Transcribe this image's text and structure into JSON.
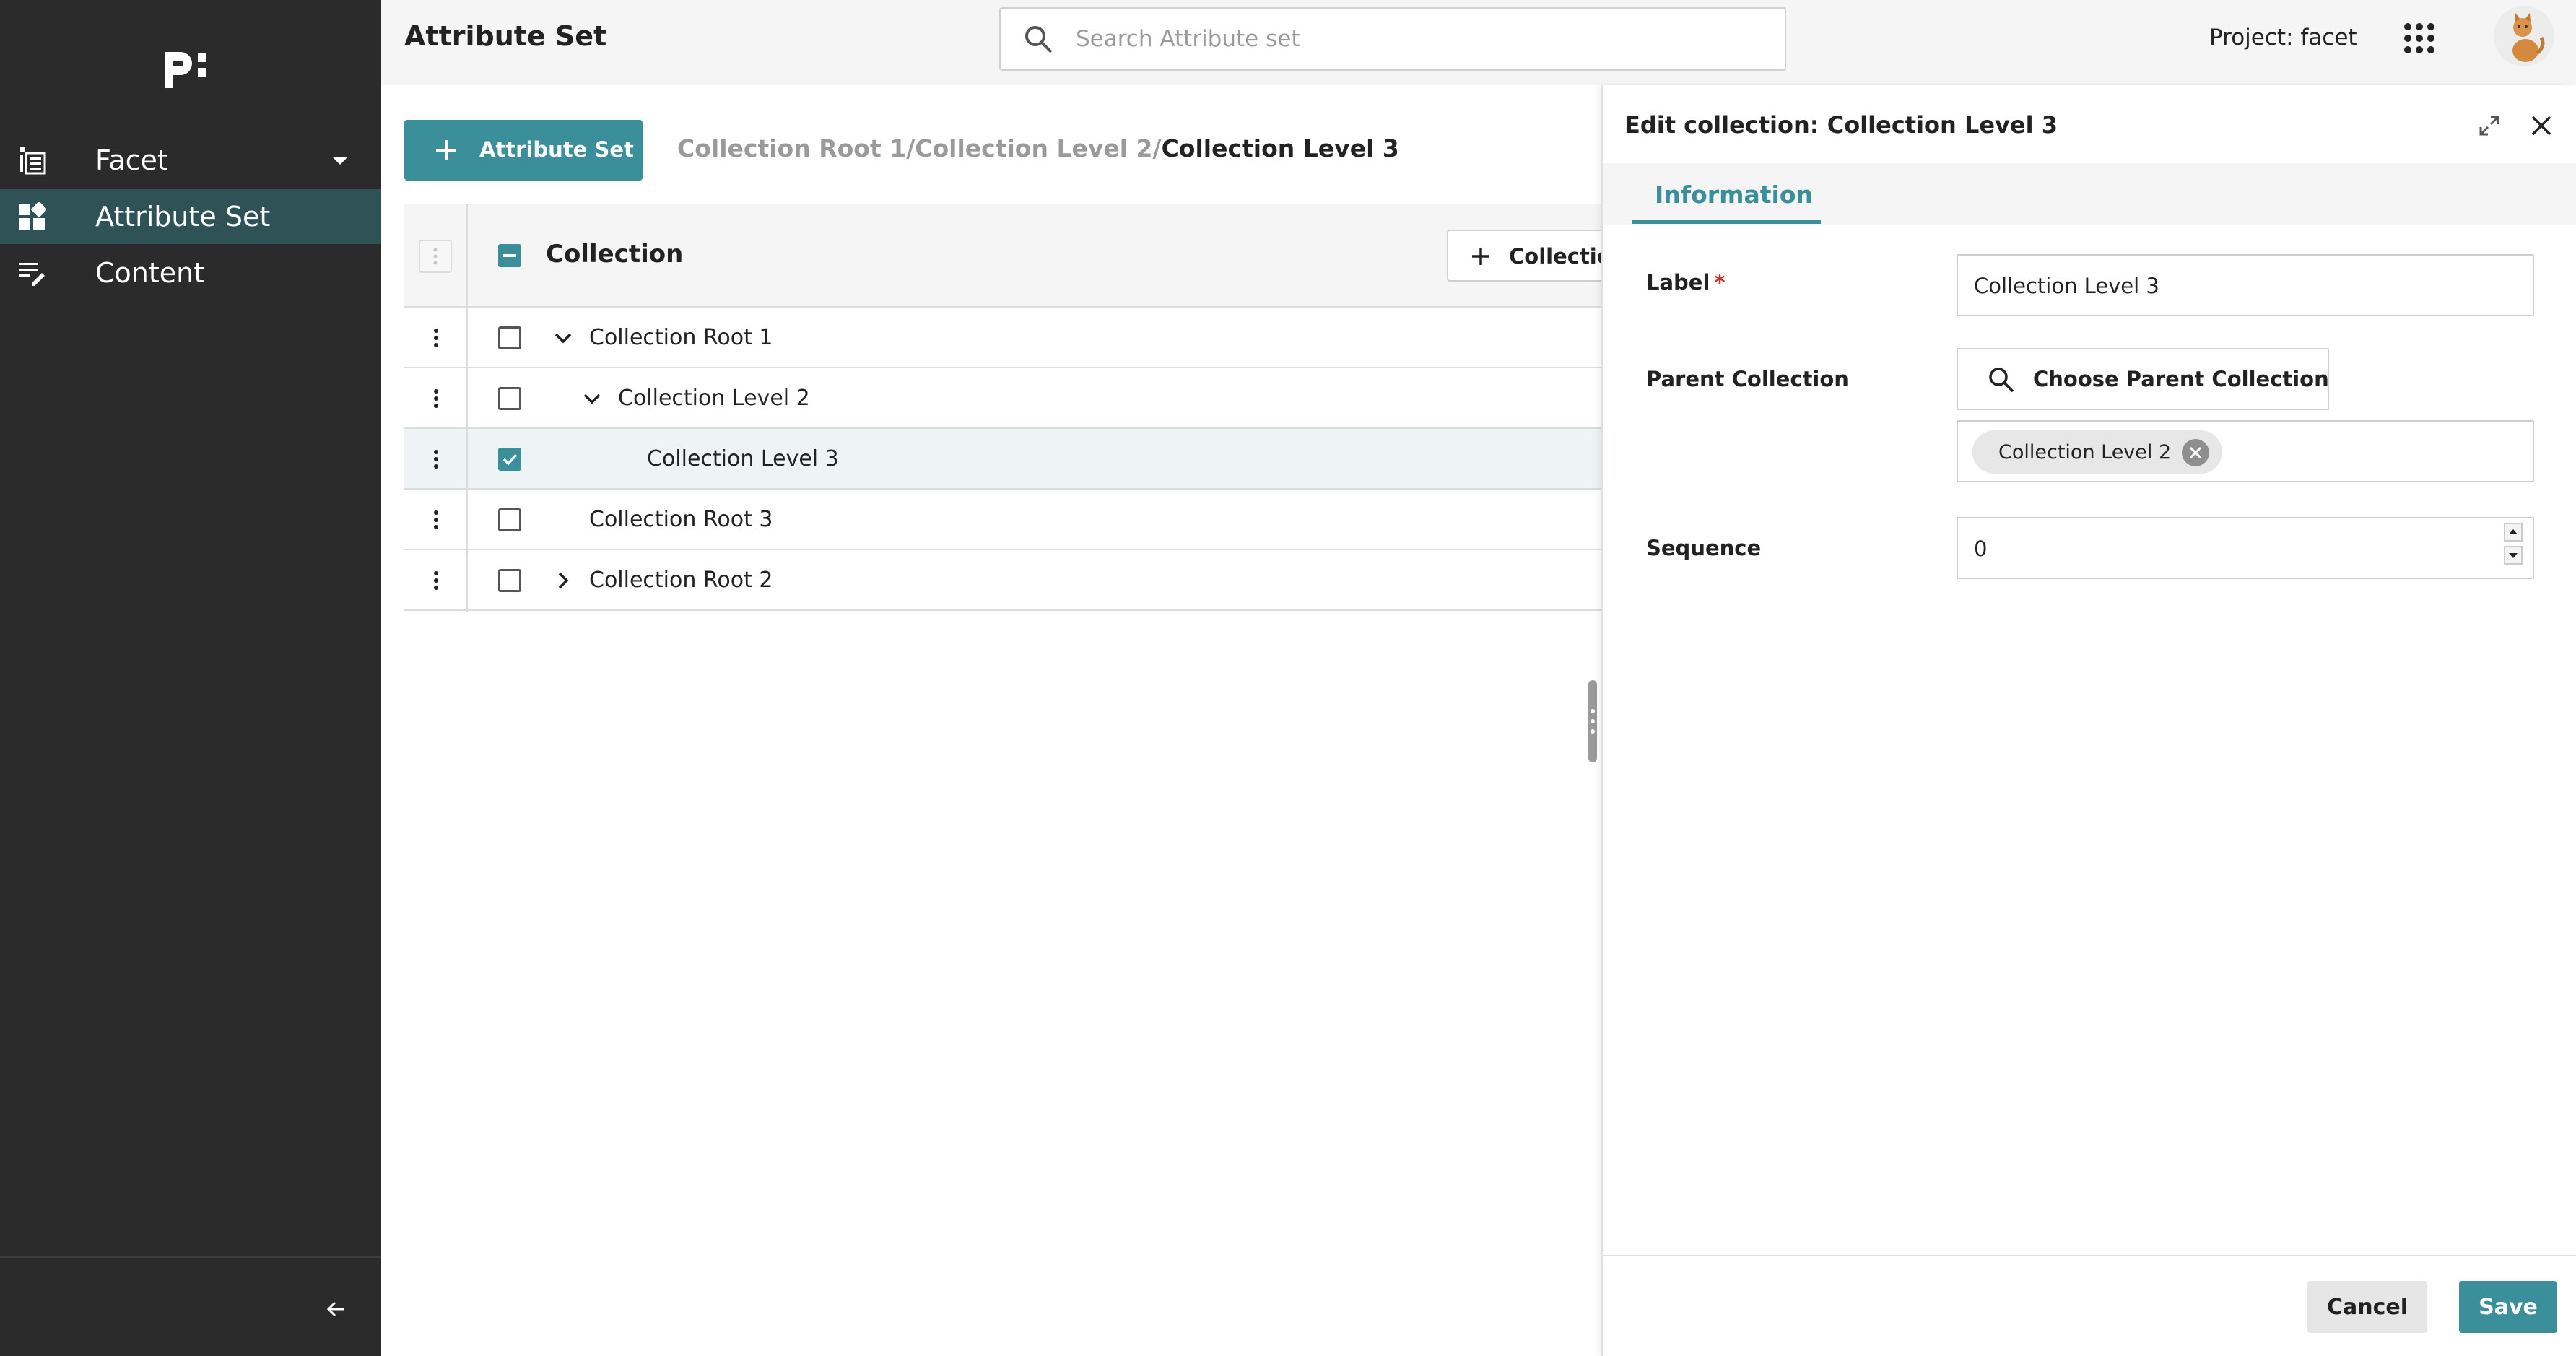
{
  "sidebar": {
    "logo_text": "p:",
    "items": [
      {
        "label": "Facet",
        "icon": "list-icon",
        "active": false,
        "has_caret": true
      },
      {
        "label": "Attribute Set",
        "icon": "dashboard-icon",
        "active": true,
        "has_caret": false
      },
      {
        "label": "Content",
        "icon": "edit-notes-icon",
        "active": false,
        "has_caret": false
      }
    ],
    "collapse_icon": "arrow-left-icon"
  },
  "header": {
    "title": "Attribute Set",
    "search": {
      "placeholder": "Search Attribute set",
      "value": ""
    },
    "project_label": "Project: facet",
    "apps_icon": "grid-apps-icon",
    "avatar_icon": "cat-avatar"
  },
  "toolbar": {
    "add_button_label": "Attribute Set",
    "breadcrumb": {
      "items": [
        "Collection Root 1",
        "Collection Level 2"
      ],
      "separator": "/",
      "current": "Collection Level 3"
    }
  },
  "table": {
    "column_title": "Collection",
    "add_collection_label": "Collection",
    "rows": [
      {
        "label": "Collection Root 1",
        "checked": false,
        "toggle": "expanded",
        "depth": 0
      },
      {
        "label": "Collection Level 2",
        "checked": false,
        "toggle": "expanded",
        "depth": 1
      },
      {
        "label": "Collection Level 3",
        "checked": true,
        "toggle": "none",
        "depth": 2
      },
      {
        "label": "Collection Root 3",
        "checked": false,
        "toggle": "none",
        "depth": 0
      },
      {
        "label": "Collection Root 2",
        "checked": false,
        "toggle": "collapsed",
        "depth": 0
      }
    ]
  },
  "panel": {
    "title": "Edit collection: Collection Level 3",
    "tabs": [
      {
        "label": "Information",
        "active": true
      }
    ],
    "fields": {
      "label": {
        "label": "Label",
        "required_mark": "*",
        "value": "Collection Level 3"
      },
      "parent": {
        "label": "Parent Collection",
        "button_label": "Choose Parent Collection",
        "chip": "Collection Level 2"
      },
      "sequence": {
        "label": "Sequence",
        "value": "0"
      }
    },
    "footer": {
      "cancel_label": "Cancel",
      "save_label": "Save"
    }
  },
  "colors": {
    "accent": "#3a8f9a",
    "sidebar_bg": "#2b2b2b",
    "sidebar_active": "#2f5257",
    "required": "#d32f2f"
  }
}
